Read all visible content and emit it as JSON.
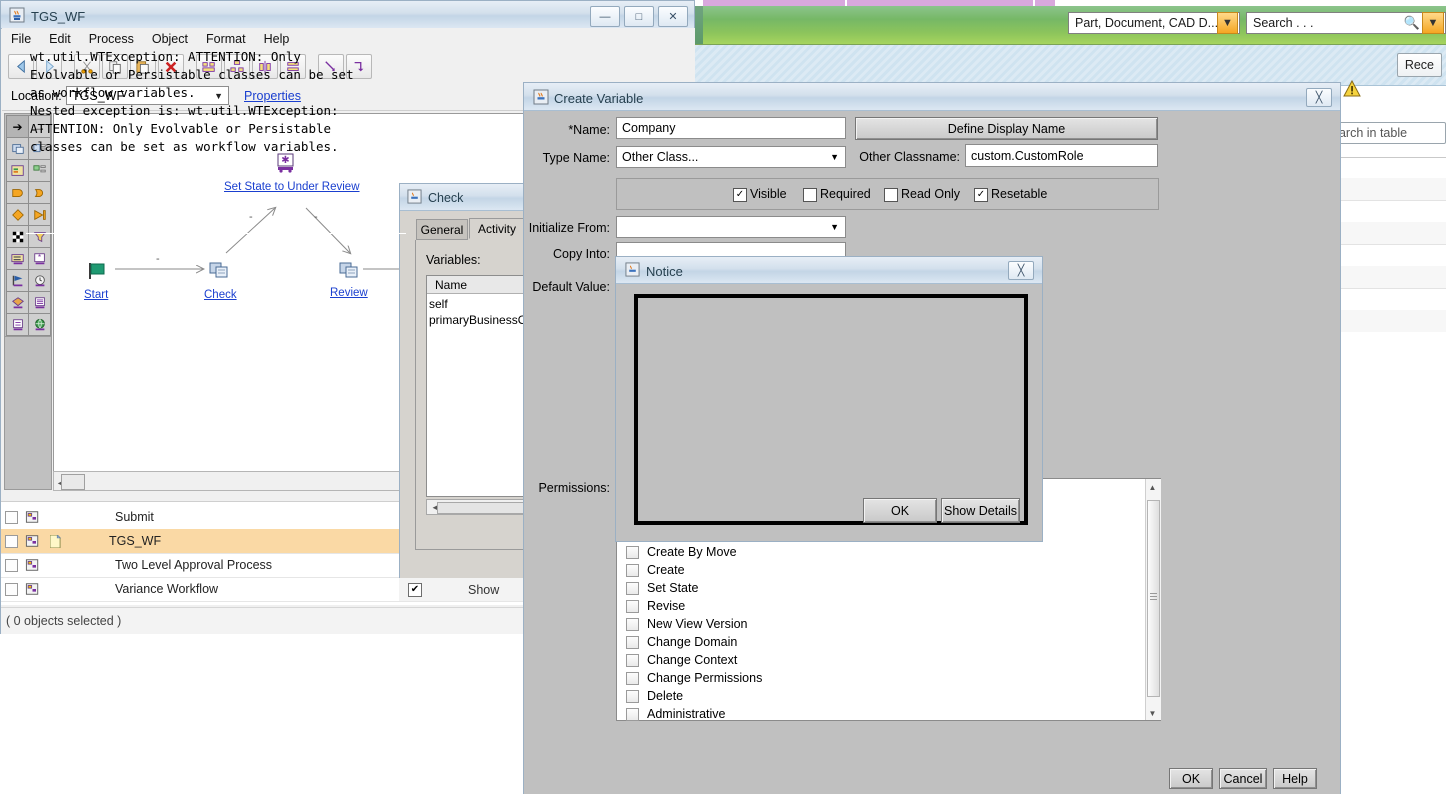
{
  "web_app": {
    "search_scope": "Part, Document, CAD D...",
    "search_placeholder": "Search . . .",
    "recent_button": "Rece",
    "table_search_placeholder": "earch in table",
    "banner_color": "#8cc45c",
    "tabstrip_color": "#d9a8dd"
  },
  "workflow_window": {
    "title": "TGS_WF",
    "menu": [
      "File",
      "Edit",
      "Process",
      "Object",
      "Format",
      "Help"
    ],
    "window_buttons": {
      "minimize": "—",
      "maximize": "□",
      "close": "✕"
    },
    "toolbar_icons": [
      "back-icon",
      "forward-icon",
      "cut-icon",
      "copy-icon",
      "paste-icon",
      "delete-icon",
      "align-nodes-icon",
      "distribute-icon",
      "align-vertical-icon",
      "align-horizontal-icon",
      "connect-link-icon",
      "route-link-icon"
    ],
    "location_label": "Location:",
    "location_value": "TGS_WF",
    "properties_link": "Properties",
    "palette_icons": [
      "select-arrow-icon",
      "link-arrow-icon",
      "activity-icon",
      "activity-list-icon",
      "block-icon",
      "block-link-icon",
      "start-shape-icon",
      "end-shape-icon",
      "decision-icon",
      "launch-icon",
      "checker-flag-icon",
      "funnel-icon",
      "form-icon",
      "event-icon",
      "flag-icon",
      "timer-icon",
      "url-icon",
      "document-icon",
      "exchange-icon",
      "globe-icon"
    ],
    "diagram": {
      "nodes": [
        {
          "name": "Start",
          "icon": "green-flag-icon"
        },
        {
          "name": "Check",
          "icon": "activity-icon"
        },
        {
          "name": "Set State to Under Review",
          "icon": "set-state-icon"
        },
        {
          "name": "Review",
          "icon": "activity-icon"
        }
      ],
      "edge_labels": [
        "-",
        "-",
        "-"
      ]
    },
    "list_rows": [
      {
        "name": "Submit",
        "selected": false,
        "has_note": false
      },
      {
        "name": "TGS_WF",
        "selected": true,
        "has_note": true
      },
      {
        "name": "Two Level Approval Process",
        "selected": false,
        "has_note": false
      },
      {
        "name": "Variance Workflow",
        "selected": false,
        "has_note": false
      }
    ],
    "status_text": "( 0 objects selected )"
  },
  "check_dialog": {
    "title": "Check",
    "tabs": [
      {
        "label": "General",
        "active": false
      },
      {
        "label": "Activity",
        "active": true
      }
    ],
    "variables_label": "Variables:",
    "variables_header": "Name",
    "variables": [
      "self",
      "primaryBusinessOb"
    ],
    "show_label": "Show",
    "show_checked": "✔"
  },
  "create_variable": {
    "title": "Create Variable",
    "name_label": "*Name:",
    "name_value": "Company",
    "define_display_name_button": "Define Display Name",
    "type_name_label": "Type Name:",
    "type_name_value": "Other Class...",
    "other_classname_label": "Other Classname:",
    "other_classname_value": "custom.CustomRole",
    "flags": [
      {
        "label": "Visible",
        "checked": true
      },
      {
        "label": "Required",
        "checked": false
      },
      {
        "label": "Read Only",
        "checked": false
      },
      {
        "label": "Resetable",
        "checked": true
      }
    ],
    "initialize_from_label": "Initialize From:",
    "initialize_from_value": "",
    "copy_into_label": "Copy Into:",
    "copy_into_value": "",
    "default_value_label": "Default Value:",
    "permissions_label": "Permissions:",
    "permissions": [
      "Create By Move",
      "Create",
      "Set State",
      "Revise",
      "New View Version",
      "Change Domain",
      "Change Context",
      "Change Permissions",
      "Delete",
      "Administrative"
    ],
    "buttons": {
      "ok": "OK",
      "cancel": "Cancel",
      "help": "Help"
    }
  },
  "notice_dialog": {
    "title": "Notice",
    "message": "wt.util.WTException: ATTENTION: Only\nEvolvable or Persistable classes can be set\nas workflow variables.\nNested exception is: wt.util.WTException:\nATTENTION: Only Evolvable or Persistable\nclasses can be set as workflow variables.",
    "ok_button": "OK",
    "details_button": "Show Details"
  }
}
